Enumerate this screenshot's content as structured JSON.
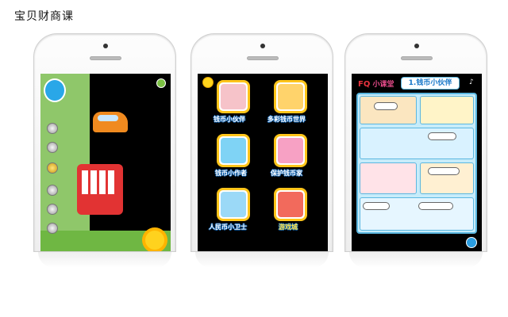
{
  "page": {
    "title": "宝贝财商课"
  },
  "phone2": {
    "tiles": [
      {
        "label": "钱币小伙伴"
      },
      {
        "label": "多彩钱币世界"
      },
      {
        "label": "钱币小作者"
      },
      {
        "label": "保护钱币家"
      },
      {
        "label": "人民币小卫士"
      },
      {
        "label": "游戏城"
      }
    ]
  },
  "phone3": {
    "logo_fq": "FQ",
    "logo_text": "小课堂",
    "lesson_title": "1.钱币小伙伴"
  }
}
